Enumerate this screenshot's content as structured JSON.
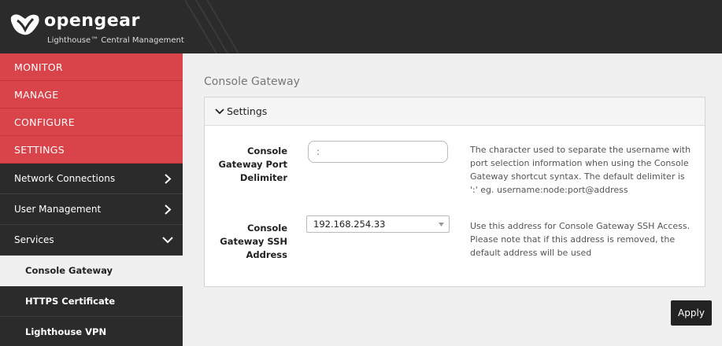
{
  "brand": {
    "name": "opengear",
    "subtitle": "Lighthouse™ Central Management"
  },
  "sidebar": {
    "main_items": [
      {
        "label": "MONITOR"
      },
      {
        "label": "MANAGE"
      },
      {
        "label": "CONFIGURE"
      },
      {
        "label": "SETTINGS"
      }
    ],
    "groups": [
      {
        "label": "Network Connections",
        "icon": "chevron-right-icon"
      },
      {
        "label": "User Management",
        "icon": "chevron-right-icon"
      },
      {
        "label": "Services",
        "icon": "chevron-down-icon"
      }
    ],
    "sub_items": [
      {
        "label": "Console Gateway",
        "active": true
      },
      {
        "label": "HTTPS Certificate",
        "active": false
      },
      {
        "label": "Lighthouse VPN",
        "active": false
      }
    ]
  },
  "main": {
    "title": "Console Gateway",
    "panel": {
      "header": "Settings",
      "fields": {
        "delimiter": {
          "label_lines": [
            "Console",
            "Gateway Port",
            "Delimiter"
          ],
          "value": ":",
          "help_lines": [
            "The character used to separate the username with",
            "port selection information when using the Console",
            "Gateway shortcut syntax. The default delimiter is",
            "':' eg. username:node:port@address"
          ]
        },
        "ssh_address": {
          "label_lines": [
            "Console",
            "Gateway SSH",
            "Address"
          ],
          "value": "192.168.254.33",
          "help_lines": [
            "Use this address for Console Gateway SSH Access.",
            "Please note that if this address is removed, the",
            "default address will be used"
          ]
        }
      }
    },
    "apply_label": "Apply"
  },
  "colors": {
    "accent_red": "#d9434a",
    "dark_bg": "#2b2b2b",
    "page_bg": "#f0f0f0"
  }
}
